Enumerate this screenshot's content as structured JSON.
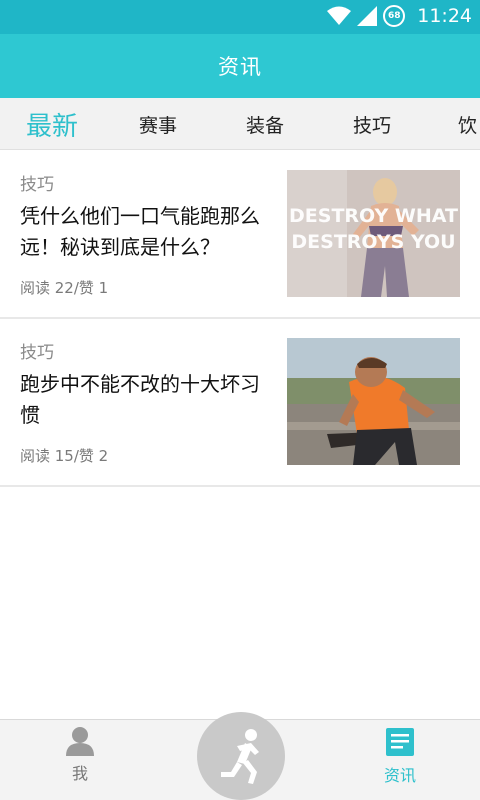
{
  "status_bar": {
    "time": "11:24",
    "battery_level": "68",
    "icons": [
      "wifi-icon",
      "signal-icon",
      "battery-icon"
    ]
  },
  "header": {
    "title": "资讯"
  },
  "tabs": [
    {
      "label": "最新",
      "active": true
    },
    {
      "label": "赛事",
      "active": false
    },
    {
      "label": "装备",
      "active": false
    },
    {
      "label": "技巧",
      "active": false
    },
    {
      "label": "饮",
      "active": false
    }
  ],
  "articles": [
    {
      "category": "技巧",
      "title": "凭什么他们一口气能跑那么远！秘诀到底是什么？",
      "stats": "阅读 22/赞 1",
      "thumb_text_1": "DESTROY WHAT",
      "thumb_text_2": "DESTROYS YOU"
    },
    {
      "category": "技巧",
      "title": "跑步中不能不改的十大坏习惯",
      "stats": "阅读 15/赞 2"
    }
  ],
  "bottom_nav": {
    "me_label": "我",
    "run_icon": "running-person-icon",
    "news_label": "资讯"
  },
  "colors": {
    "status_bar": "#1fb6c7",
    "header": "#2ec8d2",
    "accent": "#2ec0cc",
    "inactive": "#777777"
  }
}
